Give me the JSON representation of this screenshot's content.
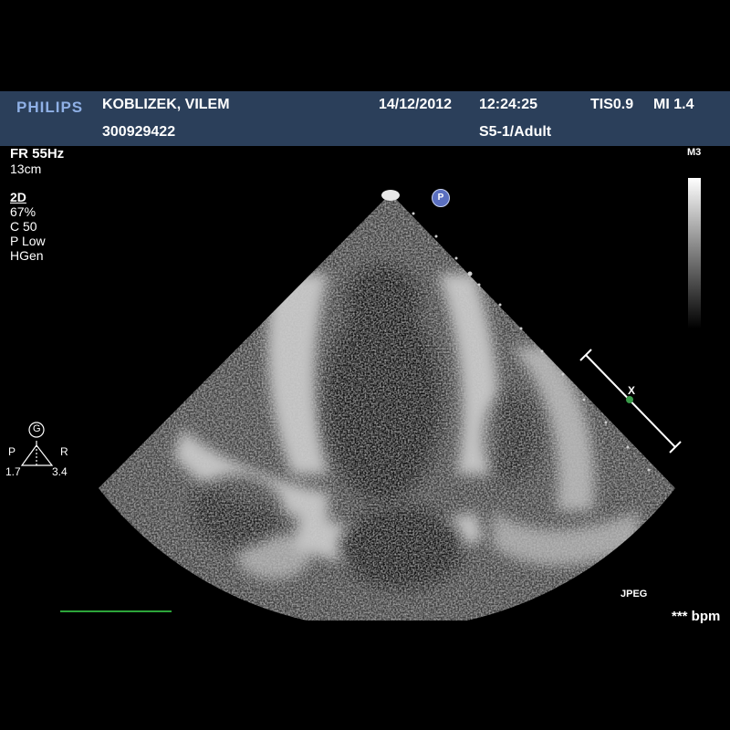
{
  "header": {
    "brand": "PHILIPS",
    "patient_name": "KOBLIZEK, VILEM",
    "patient_id": "300929422",
    "date": "14/12/2012",
    "time": "12:24:25",
    "tis": "TIS0.9",
    "mi": "MI 1.4",
    "transducer": "S5-1/Adult"
  },
  "params": {
    "frame_rate": "FR 55Hz",
    "depth": "13cm",
    "mode": "2D",
    "gain": " 67%",
    "compression": "C 50",
    "power": "P Low",
    "harmonics": "HGen"
  },
  "scale": {
    "map_label": "M3"
  },
  "orientation": {
    "marker": "G",
    "left_label": "P",
    "right_label": "R",
    "left_value": "1.7",
    "right_value": "3.4",
    "probe_marker": "P",
    "caliper_label": "X"
  },
  "footer": {
    "format": "JPEG",
    "heart_rate": "*** bpm"
  },
  "colors": {
    "header_bg": "#2b3f5a",
    "brand": "#8fb0e6",
    "ecg": "#2da53a",
    "caliper_dot": "#3a9c4a"
  }
}
